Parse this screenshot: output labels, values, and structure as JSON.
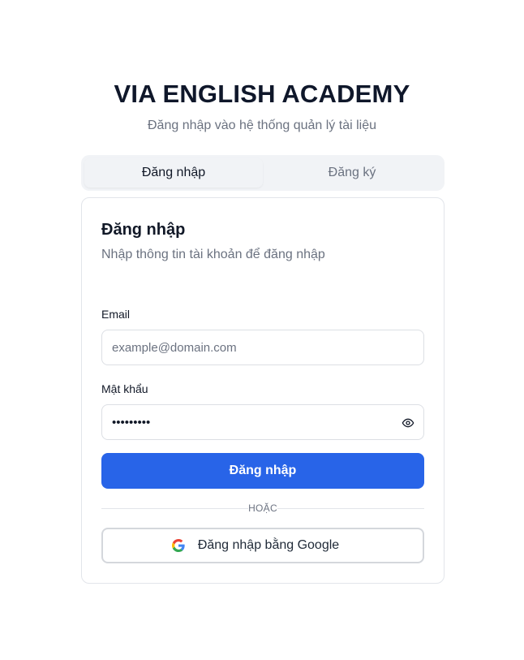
{
  "brand": {
    "title": "VIA ENGLISH ACADEMY",
    "subtitle": "Đăng nhập vào hệ thống quản lý tài liệu"
  },
  "tabs": [
    {
      "label": "Đăng nhập",
      "active": true
    },
    {
      "label": "Đăng ký",
      "active": false
    }
  ],
  "card": {
    "title": "Đăng nhập",
    "description": "Nhập thông tin tài khoản để đăng nhập"
  },
  "form": {
    "email_label": "Email",
    "email_value": "",
    "email_placeholder": "example@domain.com",
    "password_label": "Mật khẩu",
    "password_value": "password1",
    "password_toggle_icon": "eye-icon",
    "submit_label": "Đăng nhập",
    "divider_text": "HOẶC",
    "google_label": "Đăng nhập bằng Google",
    "google_icon": "google-icon"
  },
  "colors": {
    "primary": "#2864e8",
    "muted_text": "#6b7280",
    "border": "#e2e5ea",
    "tab_background": "#f1f3f6"
  }
}
